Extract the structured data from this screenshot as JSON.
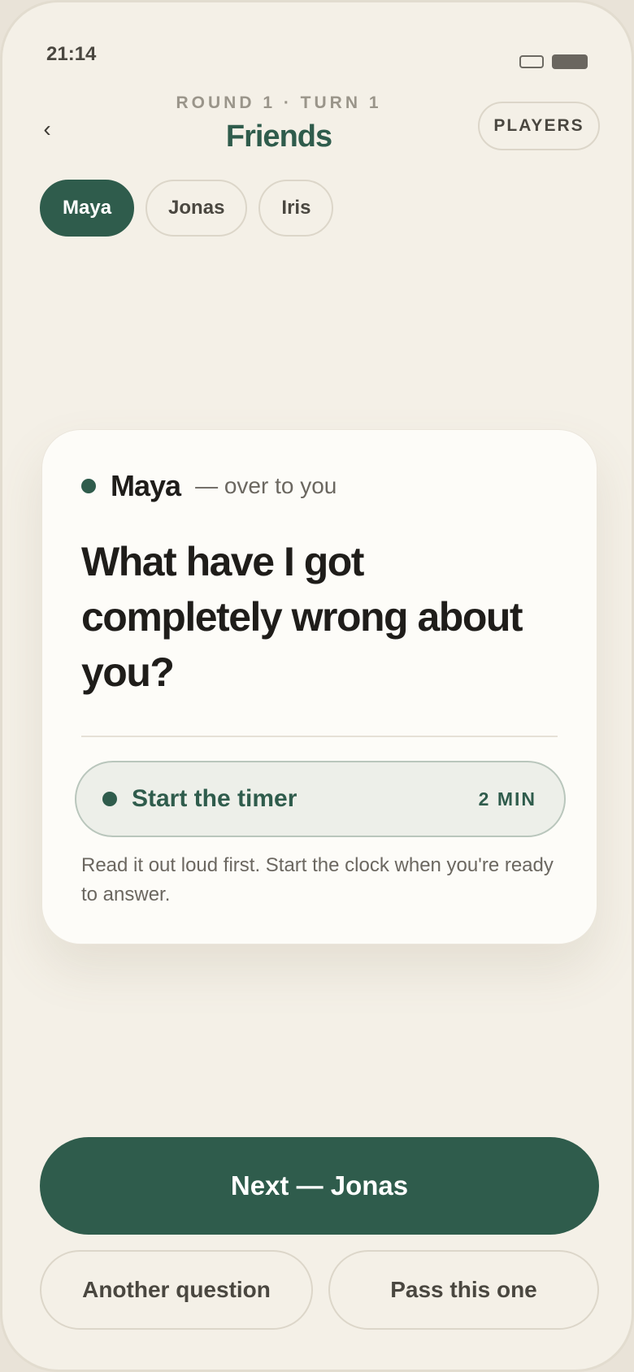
{
  "status": {
    "time": "21:14"
  },
  "header": {
    "back_icon": "‹",
    "round_label": "ROUND 1 · TURN 1",
    "deck_title": "Friends",
    "players_label": "PLAYERS"
  },
  "players": [
    {
      "name": "Maya",
      "active": true
    },
    {
      "name": "Jonas",
      "active": false
    },
    {
      "name": "Iris",
      "active": false
    }
  ],
  "card": {
    "player_name": "Maya",
    "turn_suffix": "— over to you",
    "question": "What have I got completely wrong about you?",
    "timer_label": "Start the timer",
    "timer_duration": "2 MIN",
    "hint": "Read it out loud first. Start the clock when you're ready to answer."
  },
  "actions": {
    "next_label": "Next — Jonas",
    "another_label": "Another question",
    "pass_label": "Pass this one"
  },
  "colors": {
    "accent": "#2f5c4c",
    "background": "#f4f0e7",
    "card": "#fdfcf8"
  }
}
